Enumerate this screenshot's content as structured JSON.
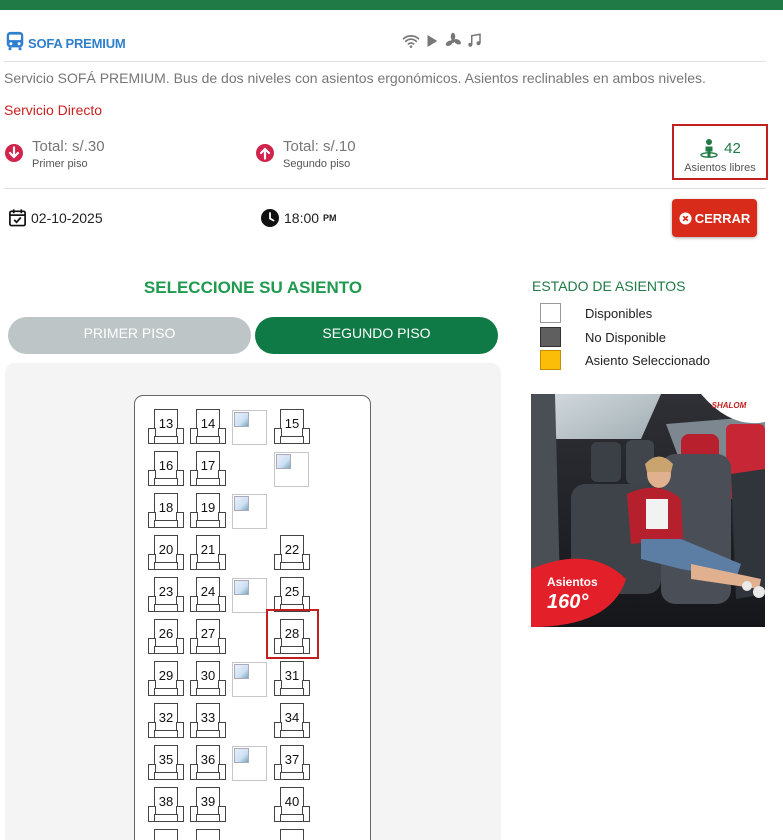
{
  "service": {
    "title": "SOFA PREMIUM",
    "description": "Servicio SOFÁ PREMIUM. Bus de dos niveles con asientos ergonómicos. Asientos reclinables en ambos niveles.",
    "type": "Servicio Directo",
    "amenities": [
      "wifi-icon",
      "play-icon",
      "fan-icon",
      "music-icon"
    ]
  },
  "prices": {
    "first": {
      "total": "Total: s/.30",
      "label": "Primer piso"
    },
    "second": {
      "total": "Total: s/.10",
      "label": "Segundo piso"
    }
  },
  "free_seats": {
    "count": "42",
    "label": "Asientos libres"
  },
  "trip": {
    "date": "02-10-2025",
    "time": "18:00",
    "ampm": "PM"
  },
  "close_button": "CERRAR",
  "select_title": "SELECCIONE SU ASIENTO",
  "tabs": {
    "first": "PRIMER PISO",
    "second": "SEGUNDO PISO",
    "active": "SEGUNDO PISO"
  },
  "legend": {
    "title": "ESTADO DE ASIENTOS",
    "items": [
      {
        "label": "Disponibles",
        "color": "#ffffff"
      },
      {
        "label": "No Disponible",
        "color": "#5f5f5f"
      },
      {
        "label": "Asiento Seleccionado",
        "color": "#fbbd08"
      }
    ]
  },
  "ad": {
    "brand": "SHALOM",
    "line1": "Asientos",
    "line2": "160°"
  },
  "seats": {
    "r1": [
      "13",
      "14",
      "15"
    ],
    "r2": [
      "16",
      "17"
    ],
    "r3": [
      "18",
      "19"
    ],
    "r4": [
      "20",
      "21",
      "22"
    ],
    "r5": [
      "23",
      "24",
      "25"
    ],
    "r6": [
      "26",
      "27",
      "28"
    ],
    "r7": [
      "29",
      "30",
      "31"
    ],
    "r8": [
      "32",
      "33",
      "34"
    ],
    "r9": [
      "35",
      "36",
      "37"
    ],
    "r10": [
      "38",
      "39",
      "40"
    ]
  },
  "colors": {
    "brand_green": "#1f7a45",
    "accent_red": "#d92b1a",
    "title_blue": "#2f7fcc"
  }
}
